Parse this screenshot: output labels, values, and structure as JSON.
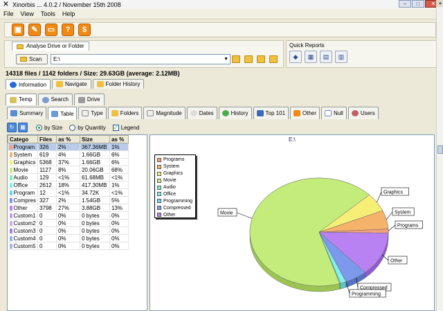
{
  "window": {
    "title": "Xinorbis ... 4.0.2 / November 15th 2008",
    "buttons": [
      "–",
      "□",
      "✕"
    ]
  },
  "menu": [
    "File",
    "View",
    "Tools",
    "Help"
  ],
  "toolbar": {
    "icons": [
      "save-icon",
      "settings-icon",
      "folder-icon",
      "help-icon",
      "donate-icon"
    ],
    "glyphs": [
      "▣",
      "✎",
      "▭",
      "?",
      "$"
    ]
  },
  "analyse": {
    "tab_label": "Analyse Drive or Folder",
    "scan_label": "Scan",
    "drive_value": "E:\\"
  },
  "quick_reports": {
    "label": "Quick Reports",
    "glyphs": [
      "◆",
      "▦",
      "▤",
      "▥"
    ]
  },
  "summary": "14318 files  /  1142 folders  /  Size: 29.63GB (average: 2.12MB)",
  "tabs_row1": [
    {
      "label": "Information",
      "active": true
    },
    {
      "label": "Navigate",
      "active": false
    },
    {
      "label": "Folder History",
      "active": false
    }
  ],
  "tabs_row2": [
    {
      "label": "Temp"
    },
    {
      "label": "Search"
    },
    {
      "label": "Drive"
    }
  ],
  "tabs_row3": [
    {
      "label": "Summary",
      "active": false
    },
    {
      "label": "Table",
      "active": true
    },
    {
      "label": "Type",
      "active": false
    },
    {
      "label": "Folders",
      "active": false
    },
    {
      "label": "Magnitude",
      "active": false
    },
    {
      "label": "Dates",
      "active": false
    },
    {
      "label": "History",
      "active": false
    },
    {
      "label": "Top 101",
      "active": false
    },
    {
      "label": "Other",
      "active": false
    },
    {
      "label": "Null",
      "active": false
    },
    {
      "label": "Users",
      "active": false
    }
  ],
  "options": {
    "by_size": "by Size",
    "by_quantity": "by Quantity",
    "legend": "Legend",
    "selected": "by Size",
    "legend_checked": true
  },
  "table": {
    "headers": [
      "Catego",
      "Files",
      "as %",
      "Size",
      "as %"
    ],
    "rows": [
      {
        "cat": "Program",
        "files": "326",
        "pct": "2%",
        "size": "367.36MB",
        "spct": "1%",
        "color": "#f6a07b",
        "selected": true
      },
      {
        "cat": "System",
        "files": "619",
        "pct": "4%",
        "size": "1.66GB",
        "spct": "6%",
        "color": "#f5b26b",
        "selected": false
      },
      {
        "cat": "Graphics",
        "files": "5368",
        "pct": "37%",
        "size": "1.66GB",
        "spct": "6%",
        "color": "#f5ef78",
        "selected": false
      },
      {
        "cat": "Movie",
        "files": "1127",
        "pct": "8%",
        "size": "20.06GB",
        "spct": "68%",
        "color": "#c4ec7b",
        "selected": false
      },
      {
        "cat": "Audio",
        "files": "129",
        "pct": "<1%",
        "size": "61.68MB",
        "spct": "<1%",
        "color": "#7eefbd",
        "selected": false
      },
      {
        "cat": "Office",
        "files": "2612",
        "pct": "18%",
        "size": "417.30MB",
        "spct": "1%",
        "color": "#82f1ee",
        "selected": false
      },
      {
        "cat": "Program",
        "files": "12",
        "pct": "<1%",
        "size": "34.72K",
        "spct": "<1%",
        "color": "#6ad2f4",
        "selected": false
      },
      {
        "cat": "Compres",
        "files": "327",
        "pct": "2%",
        "size": "1.54GB",
        "spct": "5%",
        "color": "#7d99ec",
        "selected": false
      },
      {
        "cat": "Other",
        "files": "3798",
        "pct": "27%",
        "size": "3.88GB",
        "spct": "13%",
        "color": "#b882f3",
        "selected": false
      },
      {
        "cat": "Custom1",
        "files": "0",
        "pct": "0%",
        "size": "0 bytes",
        "spct": "0%",
        "color": "#c9a0f0",
        "selected": false
      },
      {
        "cat": "Custom2",
        "files": "0",
        "pct": "0%",
        "size": "0 bytes",
        "spct": "0%",
        "color": "#d1a9f0",
        "selected": false
      },
      {
        "cat": "Custom3",
        "files": "0",
        "pct": "0%",
        "size": "0 bytes",
        "spct": "0%",
        "color": "#9e82e8",
        "selected": false
      },
      {
        "cat": "Custom4",
        "files": "0",
        "pct": "0%",
        "size": "0 bytes",
        "spct": "0%",
        "color": "#8fb5ea",
        "selected": false
      },
      {
        "cat": "Custom5",
        "files": "0",
        "pct": "0%",
        "size": "0 bytes",
        "spct": "0%",
        "color": "#b0b0e8",
        "selected": false
      }
    ]
  },
  "chart_data": {
    "type": "pie",
    "title": "E:\\",
    "legend": [
      "Programs",
      "System",
      "Graphics",
      "Movie",
      "Audio",
      "Office",
      "Programming",
      "Compressed",
      "Other"
    ],
    "series": [
      {
        "name": "Programs",
        "value": 367.36,
        "color": "#f6a07b"
      },
      {
        "name": "System",
        "value": 1700,
        "color": "#f5b26b"
      },
      {
        "name": "Graphics",
        "value": 1700,
        "color": "#f5ef78"
      },
      {
        "name": "Movie",
        "value": 20540,
        "color": "#c4ec7b"
      },
      {
        "name": "Audio",
        "value": 61.68,
        "color": "#7eefbd"
      },
      {
        "name": "Office",
        "value": 417.3,
        "color": "#82f1ee"
      },
      {
        "name": "Programming",
        "value": 0.034,
        "color": "#6ad2f4"
      },
      {
        "name": "Compressed",
        "value": 1577,
        "color": "#7d99ec"
      },
      {
        "name": "Other",
        "value": 3973,
        "color": "#b882f3"
      }
    ],
    "slice_labels": [
      "Movie",
      "Graphics",
      "System",
      "Programs",
      "Other",
      "Compressed",
      "Programming"
    ]
  }
}
